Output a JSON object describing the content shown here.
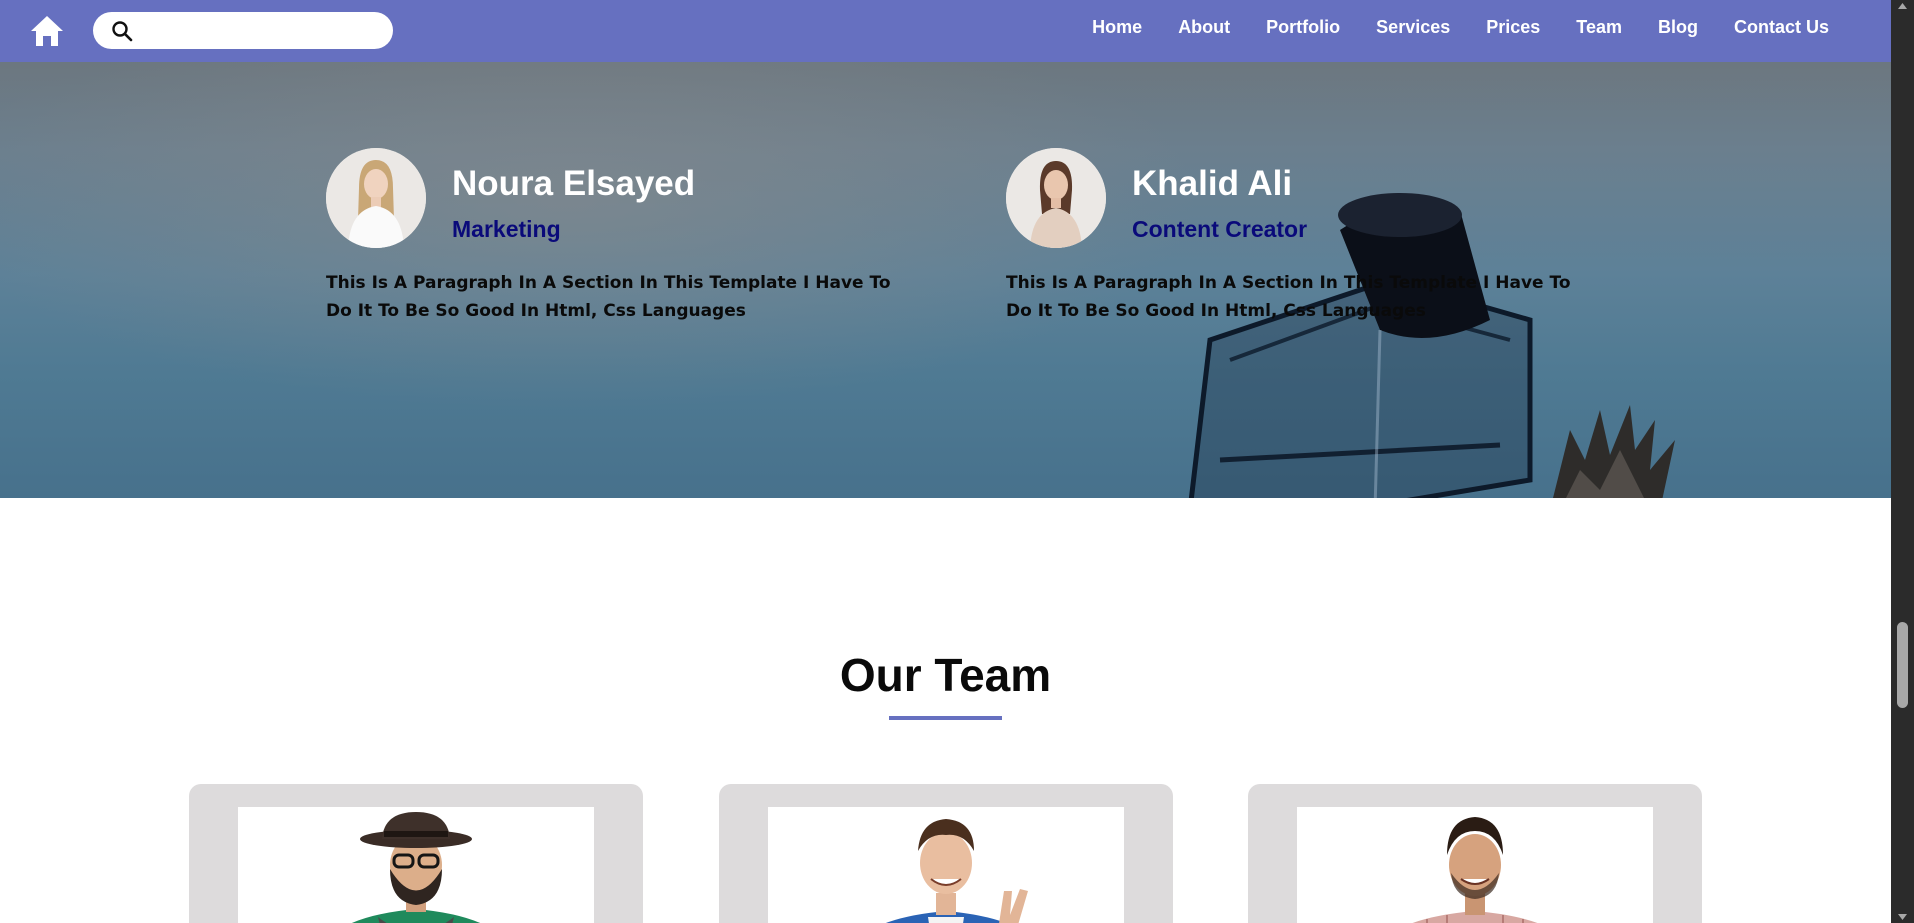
{
  "nav": {
    "home_icon": "home-icon",
    "search": {
      "placeholder": "",
      "value": "",
      "icon": "search-icon"
    },
    "links": [
      "Home",
      "About",
      "Portfolio",
      "Services",
      "Prices",
      "Team",
      "Blog",
      "Contact Us"
    ]
  },
  "testimonials": [
    {
      "name": "Noura Elsayed",
      "role": "Marketing",
      "text": "This Is A Paragraph In A Section In This Template I Have To Do It To Be So Good In Html, Css Languages"
    },
    {
      "name": "Khalid Ali",
      "role": "Content Creator",
      "text": "This Is A Paragraph In A Section In This Template I Have To Do It To Be So Good In Html, Css Languages"
    }
  ],
  "team": {
    "title": "Our Team"
  },
  "colors": {
    "accent": "#6670c0",
    "role_text": "#0a0a7a",
    "card_bg": "#dddbdc"
  }
}
